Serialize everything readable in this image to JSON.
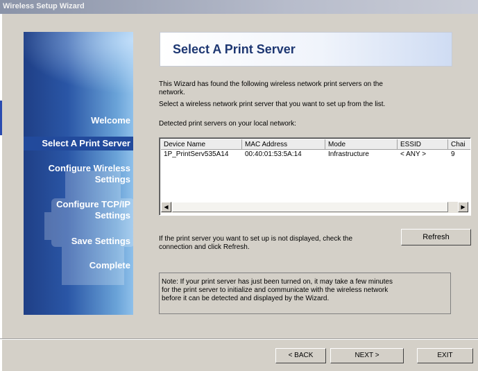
{
  "window": {
    "title": "Wireless Setup Wizard"
  },
  "sidebar": {
    "items": [
      {
        "label": "Welcome"
      },
      {
        "label": "Select A Print Server"
      },
      {
        "label": "Configure Wireless"
      },
      {
        "label": "Settings"
      },
      {
        "label": "Configure TCP/IP"
      },
      {
        "label": "Settings"
      },
      {
        "label": "Save Settings"
      },
      {
        "label": "Complete"
      }
    ]
  },
  "header": {
    "title": "Select A Print Server"
  },
  "body": {
    "intro_line1": "This Wizard has found the following wireless network print servers on the",
    "intro_line2": "network.",
    "intro_line3": "Select a wireless network print server that you want to set up from the list.",
    "detected_label": "Detected print servers on your local network:",
    "refresh_text_line1": "If the print server you want to set up is not displayed, check the",
    "refresh_text_line2": "connection and click Refresh.",
    "note_line1": "Note: If your print server has just been turned on, it may take a few minutes",
    "note_line2": "for the print server to initialize and communicate with the wireless network",
    "note_line3": "before it can be detected and displayed by the Wizard."
  },
  "table": {
    "columns": [
      "Device Name",
      "MAC Address",
      "Mode",
      "ESSID",
      "Chai"
    ],
    "rows": [
      [
        "1P_PrintServ535A14",
        "00:40:01:53:5A:14",
        "Infrastructure",
        "< ANY >",
        "9"
      ]
    ]
  },
  "scroll": {
    "left_arrow": "◀",
    "right_arrow": "▶"
  },
  "buttons": {
    "refresh": "Refresh",
    "back": "< BACK",
    "next": "NEXT >",
    "exit": "EXIT"
  }
}
